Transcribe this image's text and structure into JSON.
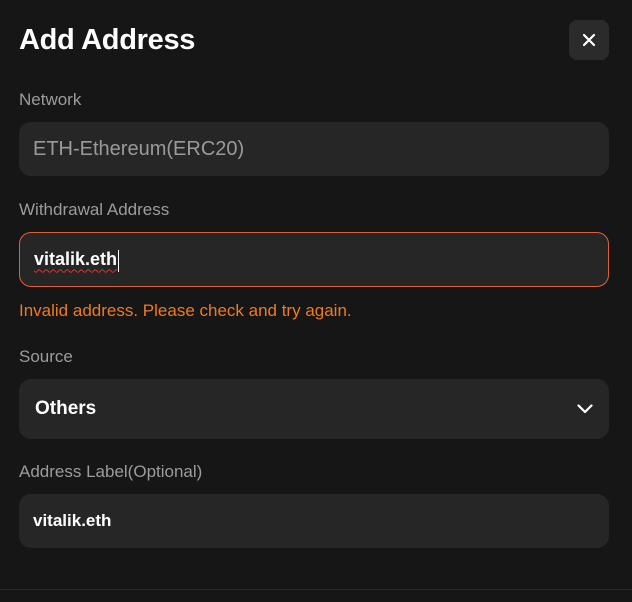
{
  "dialog": {
    "title": "Add Address",
    "close_icon": "close-icon"
  },
  "network": {
    "label": "Network",
    "value": "ETH-Ethereum(ERC20)"
  },
  "withdrawal_address": {
    "label": "Withdrawal Address",
    "value": "vitalik.eth",
    "error": "Invalid address. Please check and try again.",
    "border_color": "#e0603a",
    "error_color": "#f07a1e"
  },
  "source": {
    "label": "Source",
    "selected": "Others",
    "chevron_icon": "chevron-down-icon"
  },
  "address_label": {
    "label": "Address Label(Optional)",
    "value": "vitalik.eth"
  }
}
